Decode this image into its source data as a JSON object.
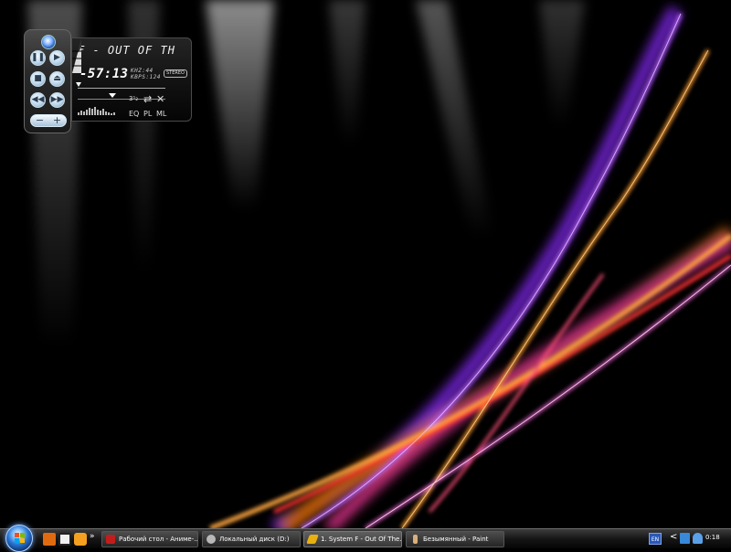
{
  "player": {
    "song": "F - OUT OF TH",
    "time": "-57:13",
    "khz": "KHZ:44",
    "kbps": "KBPS:124",
    "stereo": "STEREO",
    "eq_label": "EQ",
    "pl_label": "PL",
    "ml_label": "ML",
    "shuffle_label": "3¹₂",
    "volume_minus": "−",
    "volume_plus": "+"
  },
  "taskbar": {
    "tasks": [
      {
        "label": "Рабочий стол - Аниме-..."
      },
      {
        "label": "Локальный диск (D:)"
      },
      {
        "label": "1. System F - Out Of The..."
      },
      {
        "label": "Безымянный - Paint"
      }
    ],
    "quick_launch_more": "»",
    "language": "EN",
    "tray_chevron": "<",
    "clock": "0:18"
  },
  "colors": {
    "purple_streak": "#9b3cff",
    "orange_streak": "#ff8a1e",
    "pink_streak": "#ff4fd8",
    "red_streak": "#ff3a2a"
  }
}
